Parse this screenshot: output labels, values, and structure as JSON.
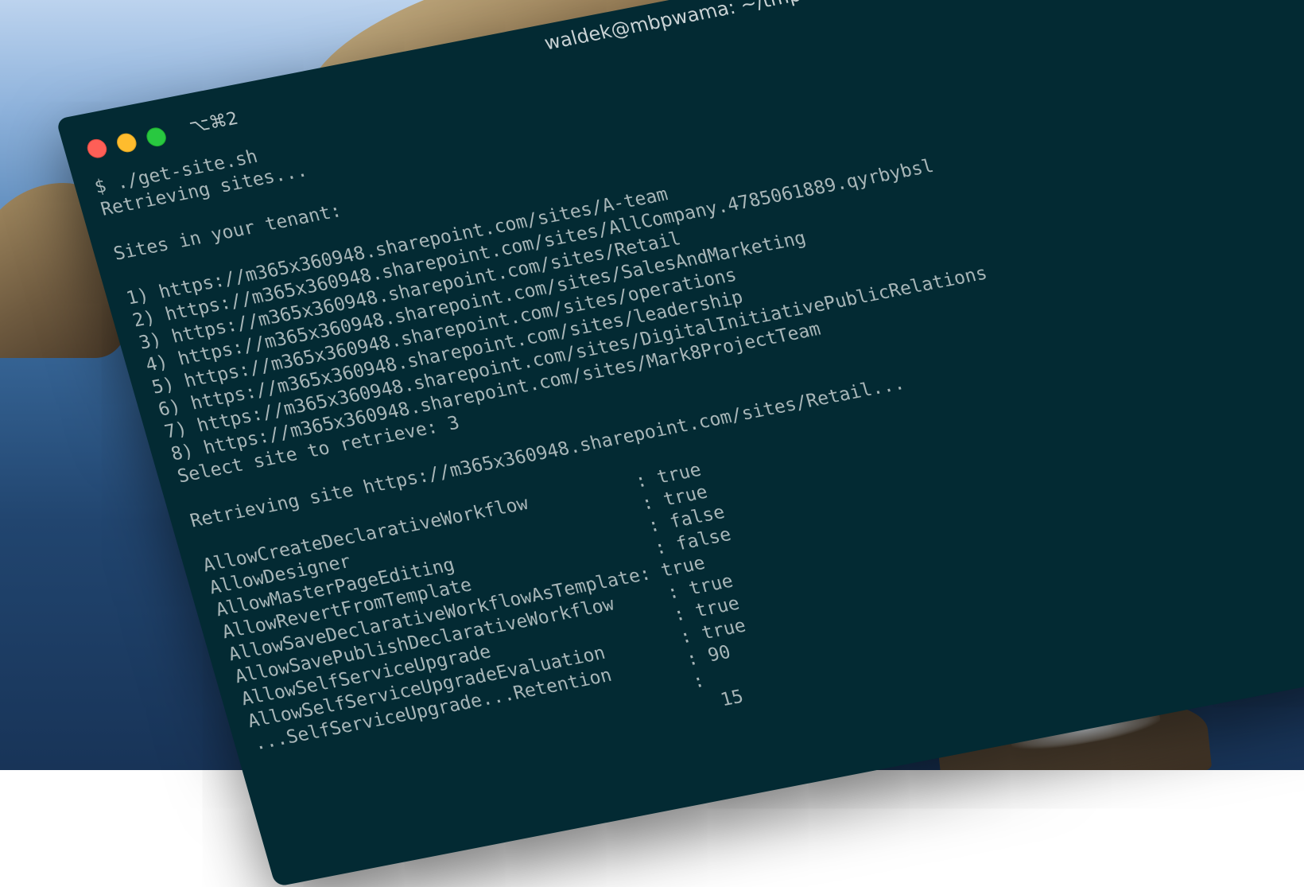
{
  "window": {
    "title": "waldek@mbpwama: ~/tmp",
    "tab_shortcut": "⌥⌘2"
  },
  "colors": {
    "terminal_bg": "#032a33",
    "terminal_text": "#a8b6b8",
    "close": "#fe5f57",
    "minimize": "#febc2e",
    "zoom": "#28c840"
  },
  "lines": [
    "$ ./get-site.sh",
    "Retrieving sites...",
    "",
    "Sites in your tenant:",
    "",
    "1) https://m365x360948.sharepoint.com/sites/A-team",
    "2) https://m365x360948.sharepoint.com/sites/AllCompany.4785061889.qyrbybsl",
    "3) https://m365x360948.sharepoint.com/sites/Retail",
    "4) https://m365x360948.sharepoint.com/sites/SalesAndMarketing",
    "5) https://m365x360948.sharepoint.com/sites/operations",
    "6) https://m365x360948.sharepoint.com/sites/leadership",
    "7) https://m365x360948.sharepoint.com/sites/DigitalInitiativePublicRelations",
    "8) https://m365x360948.sharepoint.com/sites/Mark8ProjectTeam",
    "Select site to retrieve: 3",
    "",
    "Retrieving site https://m365x360948.sharepoint.com/sites/Retail...",
    "",
    "AllowCreateDeclarativeWorkflow          : true",
    "AllowDesigner                           : true",
    "AllowMasterPageEditing                  : false",
    "AllowRevertFromTemplate                 : false",
    "AllowSaveDeclarativeWorkflowAsTemplate: true",
    "AllowSavePublishDeclarativeWorkflow     : true",
    "AllowSelfServiceUpgrade                 : true",
    "AllowSelfServiceUpgradeEvaluation       : true",
    "...SelfServiceUpgrade...Retention       : 90",
    "                                        :",
    "                                          15"
  ]
}
